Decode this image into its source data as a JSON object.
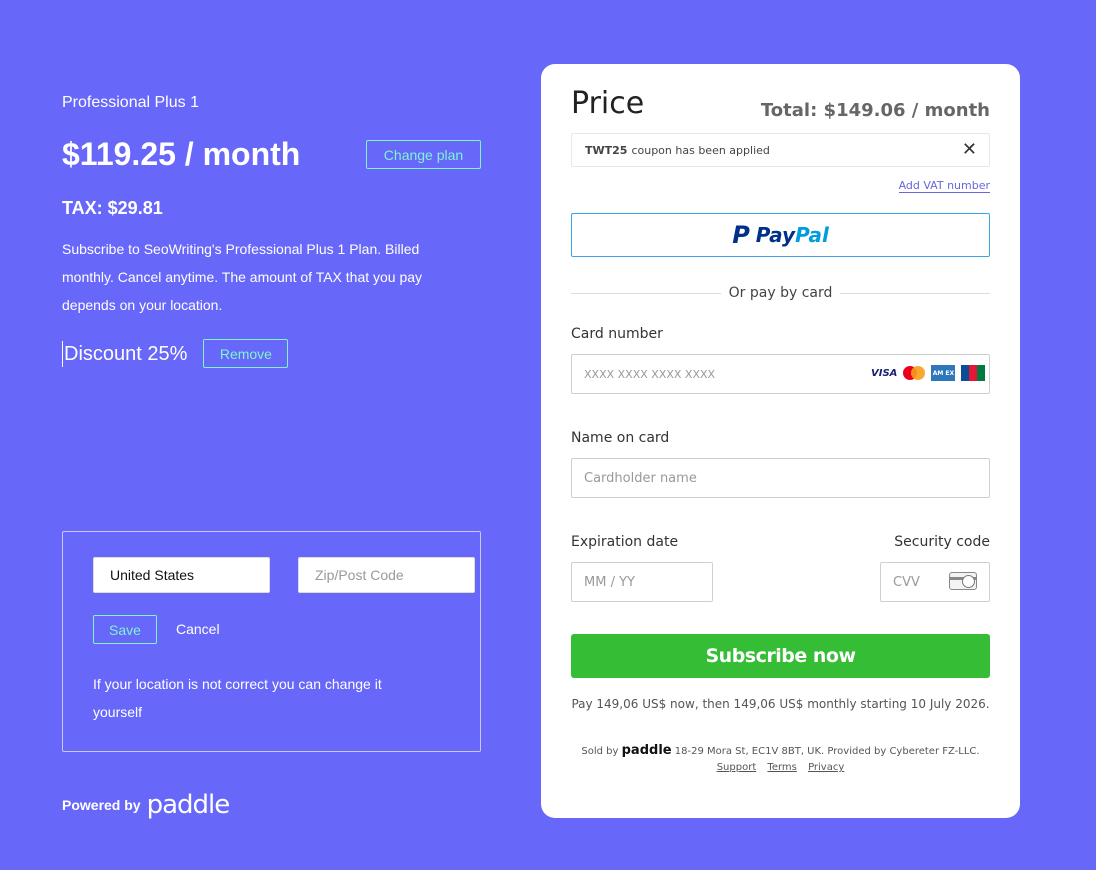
{
  "plan": {
    "name": "Professional Plus 1",
    "price": "$119.25 / month",
    "change_plan_label": "Change plan",
    "tax": "TAX: $29.81",
    "description": "Subscribe to SeoWriting's Professional Plus 1 Plan. Billed monthly. Cancel anytime. The amount of TAX that you pay depends on your location.",
    "discount": "Discount 25%",
    "remove_label": "Remove"
  },
  "location": {
    "country_value": "United States",
    "zip_placeholder": "Zip/Post Code",
    "save_label": "Save",
    "cancel_label": "Cancel",
    "note": "If your location is not correct you can change it yourself"
  },
  "footer": {
    "powered_by": "Powered by",
    "paddle_logo": "paddle"
  },
  "checkout": {
    "title": "Price",
    "total": "Total:  $149.06 / month",
    "coupon_code": "TWT25",
    "coupon_text": "coupon has been applied",
    "vat_link": "Add VAT number",
    "paypal_mark": "P",
    "paypal_pay": "Pay",
    "paypal_pal": "Pal",
    "or_text": "Or pay by card",
    "card_number_label": "Card number",
    "card_number_placeholder": "XXXX XXXX XXXX XXXX",
    "brands": {
      "visa": "VISA",
      "amex": "AM EX"
    },
    "name_label": "Name on card",
    "name_placeholder": "Cardholder name",
    "exp_label": "Expiration date",
    "exp_placeholder": "MM / YY",
    "cvv_label": "Security code",
    "cvv_placeholder": "CVV",
    "subscribe_label": "Subscribe now",
    "pay_note": "Pay 149,06 US$ now, then 149,06 US$ monthly starting 10 July 2026.",
    "sold_by": "Sold by",
    "sold_logo": "paddle",
    "sold_address": "18-29 Mora St, EC1V 8BT, UK.  Provided by  Cybereter FZ-LLC.",
    "links": [
      "Support",
      "Terms",
      "Privacy"
    ]
  },
  "colors": {
    "background": "#6767f9",
    "accent_outline": "#7ef5d4",
    "subscribe_green": "#35bd35",
    "paypal_border": "#3ba3e8"
  }
}
